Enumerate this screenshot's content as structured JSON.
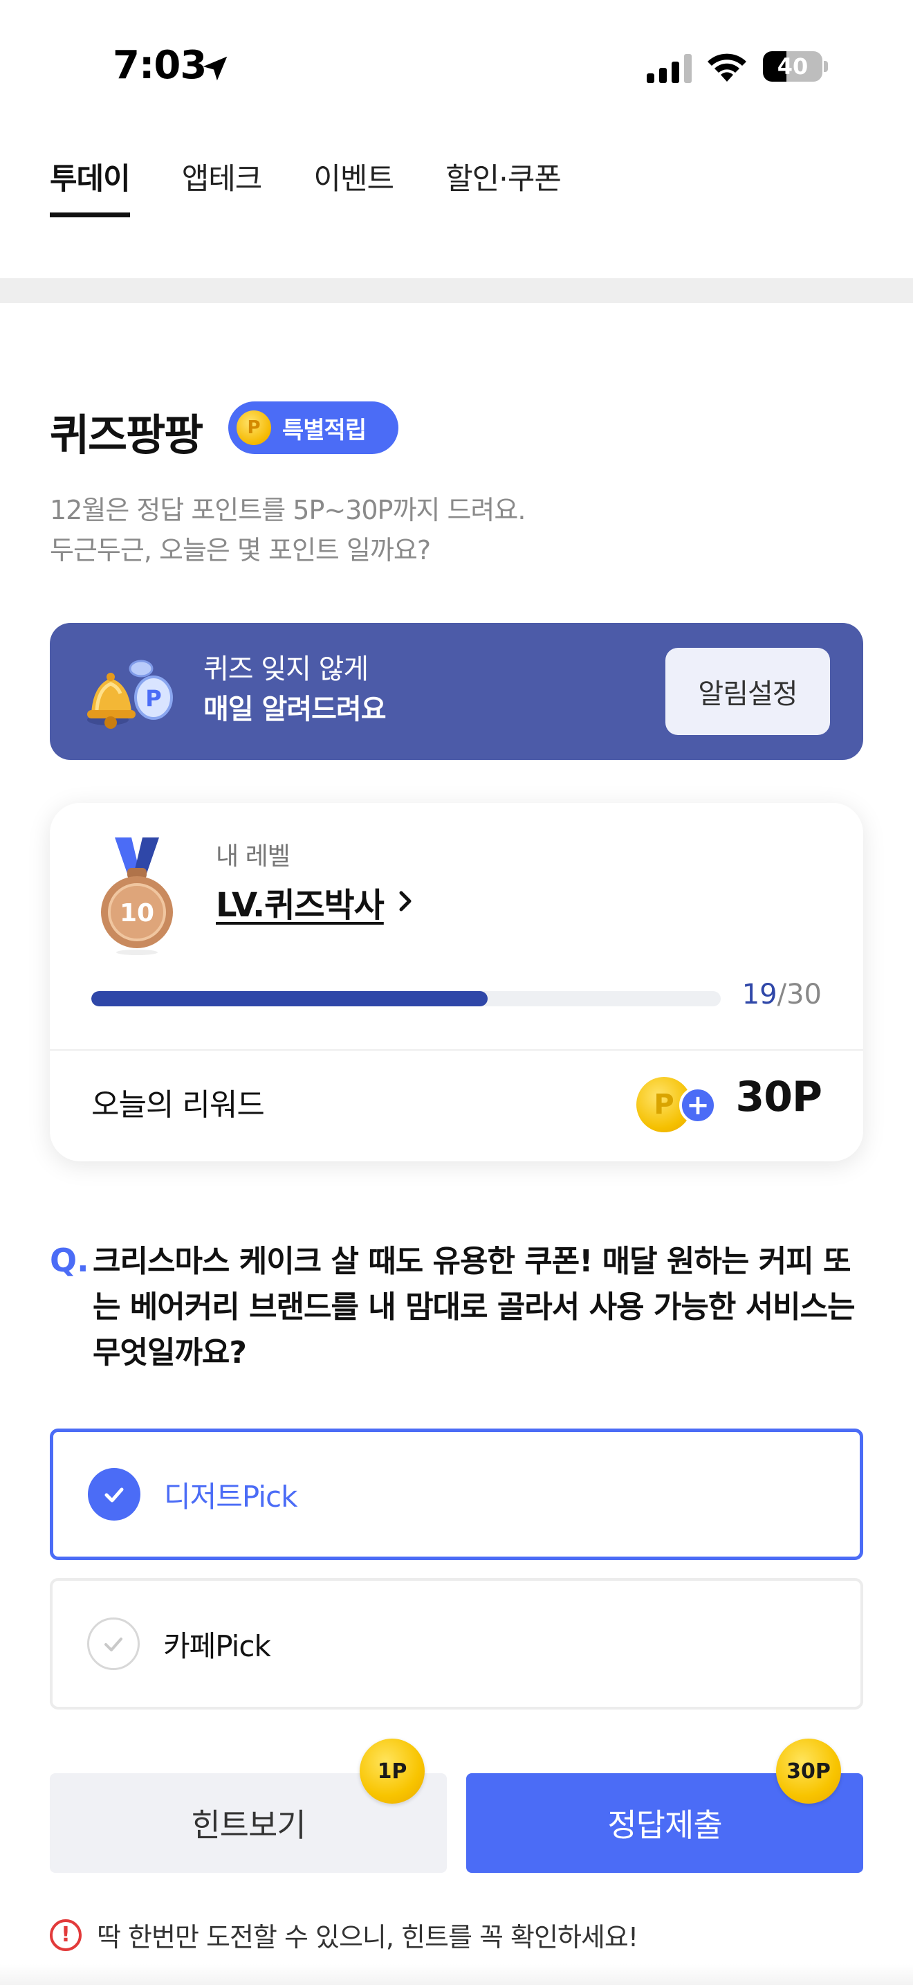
{
  "status_bar": {
    "time": "7:03",
    "battery": "40",
    "battery_level": 0.4
  },
  "tabs": [
    {
      "label": "투데이",
      "active": true
    },
    {
      "label": "앱테크",
      "active": false
    },
    {
      "label": "이벤트",
      "active": false
    },
    {
      "label": "할인·쿠폰",
      "active": false
    }
  ],
  "quiz": {
    "title": "퀴즈팡팡",
    "badge": "특별적립",
    "desc_line1": "12월은 정답 포인트를 5P~30P까지 드려요.",
    "desc_line2": "두근두근, 오늘은 몇 포인트 일까요?"
  },
  "alarm": {
    "line1": "퀴즈 잊지 않게",
    "line2": "매일 알려드려요",
    "button": "알림설정"
  },
  "level": {
    "label": "내 레벨",
    "name": "LV.퀴즈박사",
    "medal_number": "10",
    "current": "19",
    "total": "/30",
    "progress": 0.63
  },
  "reward": {
    "label": "오늘의 리워드",
    "value": "30P"
  },
  "question": {
    "mark": "Q.",
    "text": "크리스마스 케이크 살 때도 유용한 쿠폰! 매달 원하는 커피 또는 베어커리 브랜드를 내 맘대로 골라서 사용 가능한 서비스는 무엇일까요?"
  },
  "options": [
    {
      "label": "디저트Pick",
      "selected": true
    },
    {
      "label": "카페Pick",
      "selected": false
    }
  ],
  "buttons": {
    "hint": "힌트보기",
    "hint_cost": "1P",
    "submit": "정답제출",
    "submit_cost": "30P"
  },
  "warning": "딱 한번만 도전할 수 있으니, 힌트를 꼭 확인하세요!",
  "colors": {
    "accent": "#4b6cf6",
    "banner": "#4c5ba8",
    "progress": "#2f47a8",
    "warning": "#e23a3a"
  }
}
